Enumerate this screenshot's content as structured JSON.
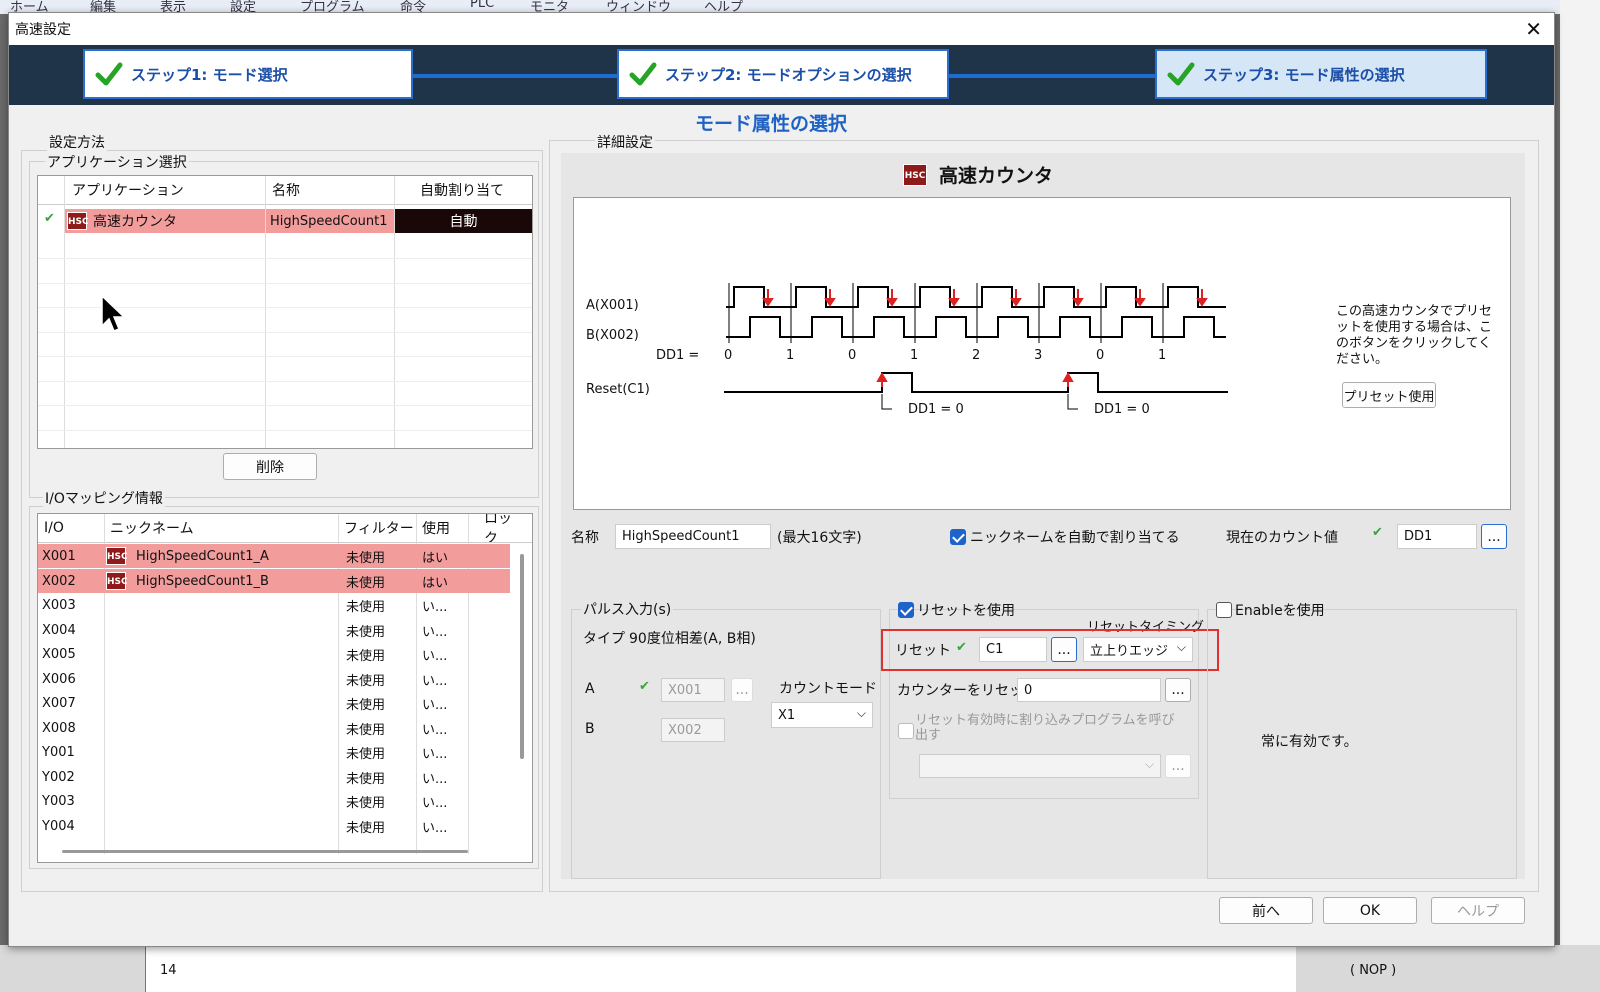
{
  "background": {
    "menu": [
      "ホーム",
      "編集",
      "表示",
      "設定",
      "プログラム",
      "命令",
      "PLC",
      "モニタ",
      "ウィンドウ",
      "ヘルプ"
    ],
    "row_number": "14",
    "nop": "( NOP )"
  },
  "dialog": {
    "title": "高速設定",
    "steps": [
      {
        "label": "ステップ1:  モード選択"
      },
      {
        "label": "ステップ2:  モードオプションの選択"
      },
      {
        "label": "ステップ3:  モード属性の選択"
      }
    ],
    "heading": "モード属性の選択"
  },
  "left": {
    "settings_legend": "設定方法",
    "app_legend": "アプリケーション選択",
    "app_table": {
      "columns": [
        "アプリケーション",
        "名称",
        "自動割り当て"
      ],
      "row": {
        "app": "高速カウンタ",
        "name": "HighSpeedCount1",
        "auto": "自動"
      }
    },
    "delete_button": "削除",
    "io_legend": "I/Oマッピング情報",
    "io_table": {
      "columns": [
        "I/O",
        "ニックネーム",
        "フィルター",
        "使用",
        "ロック"
      ],
      "rows": [
        {
          "io": "X001",
          "nick": "HighSpeedCount1_A",
          "filter": "未使用",
          "use": "はい"
        },
        {
          "io": "X002",
          "nick": "HighSpeedCount1_B",
          "filter": "未使用",
          "use": "はい"
        },
        {
          "io": "X003",
          "nick": "",
          "filter": "未使用",
          "use": "い..."
        },
        {
          "io": "X004",
          "nick": "",
          "filter": "未使用",
          "use": "い..."
        },
        {
          "io": "X005",
          "nick": "",
          "filter": "未使用",
          "use": "い..."
        },
        {
          "io": "X006",
          "nick": "",
          "filter": "未使用",
          "use": "い..."
        },
        {
          "io": "X007",
          "nick": "",
          "filter": "未使用",
          "use": "い..."
        },
        {
          "io": "X008",
          "nick": "",
          "filter": "未使用",
          "use": "い..."
        },
        {
          "io": "Y001",
          "nick": "",
          "filter": "未使用",
          "use": "い..."
        },
        {
          "io": "Y002",
          "nick": "",
          "filter": "未使用",
          "use": "い..."
        },
        {
          "io": "Y003",
          "nick": "",
          "filter": "未使用",
          "use": "い..."
        },
        {
          "io": "Y004",
          "nick": "",
          "filter": "未使用",
          "use": "い..."
        }
      ]
    }
  },
  "right": {
    "detail_legend": "詳細設定",
    "hsc_badge": "HSC",
    "counter_title": "高速カウンタ",
    "diagram": {
      "a_label": "A(X001)",
      "b_label": "B(X002)",
      "dd1_label": "DD1 =",
      "dd1_values": [
        "0",
        "1",
        "0",
        "1",
        "2",
        "3",
        "0",
        "1"
      ],
      "reset_label": "Reset(C1)",
      "reset_note": "DD1 = 0"
    },
    "preset_info": "この高速カウンタでプリセットを使用する場合は、このボタンをクリックしてください。",
    "preset_button": "プリセット使用",
    "name_label": "名称",
    "name_value": "HighSpeedCount1",
    "name_max": "(最大16文字)",
    "auto_nick_label": "ニックネームを自動で割り当てる",
    "current_count_label": "現在のカウント値",
    "current_count_value": "DD1",
    "pulse": {
      "legend": "パルス入力(s)",
      "type_label": "タイプ",
      "type_value": "90度位相差(A, B相)",
      "a_label": "A",
      "a_value": "X001",
      "b_label": "B",
      "b_value": "X002",
      "count_mode_label": "カウントモード",
      "count_mode_value": "X1"
    },
    "reset": {
      "use_label": "リセットを使用",
      "timing_label": "リセットタイミング",
      "reset_label": "リセット",
      "reset_value": "C1",
      "timing_value": "立上りエッジ",
      "counter_reset_label": "カウンターをリセット",
      "counter_reset_value": "0",
      "interrupt_label": "リセット有効時に割り込みプログラムを呼び出す"
    },
    "enable": {
      "label": "Enableを使用",
      "note": "常に有効です。"
    }
  },
  "footer": {
    "prev": "前へ",
    "ok": "OK",
    "help": "ヘルプ"
  },
  "ellipsis": "...",
  "colors": {
    "accent": "#1e63c9",
    "selected_row": "#f29c9c",
    "highlight_box": "#e03030"
  }
}
